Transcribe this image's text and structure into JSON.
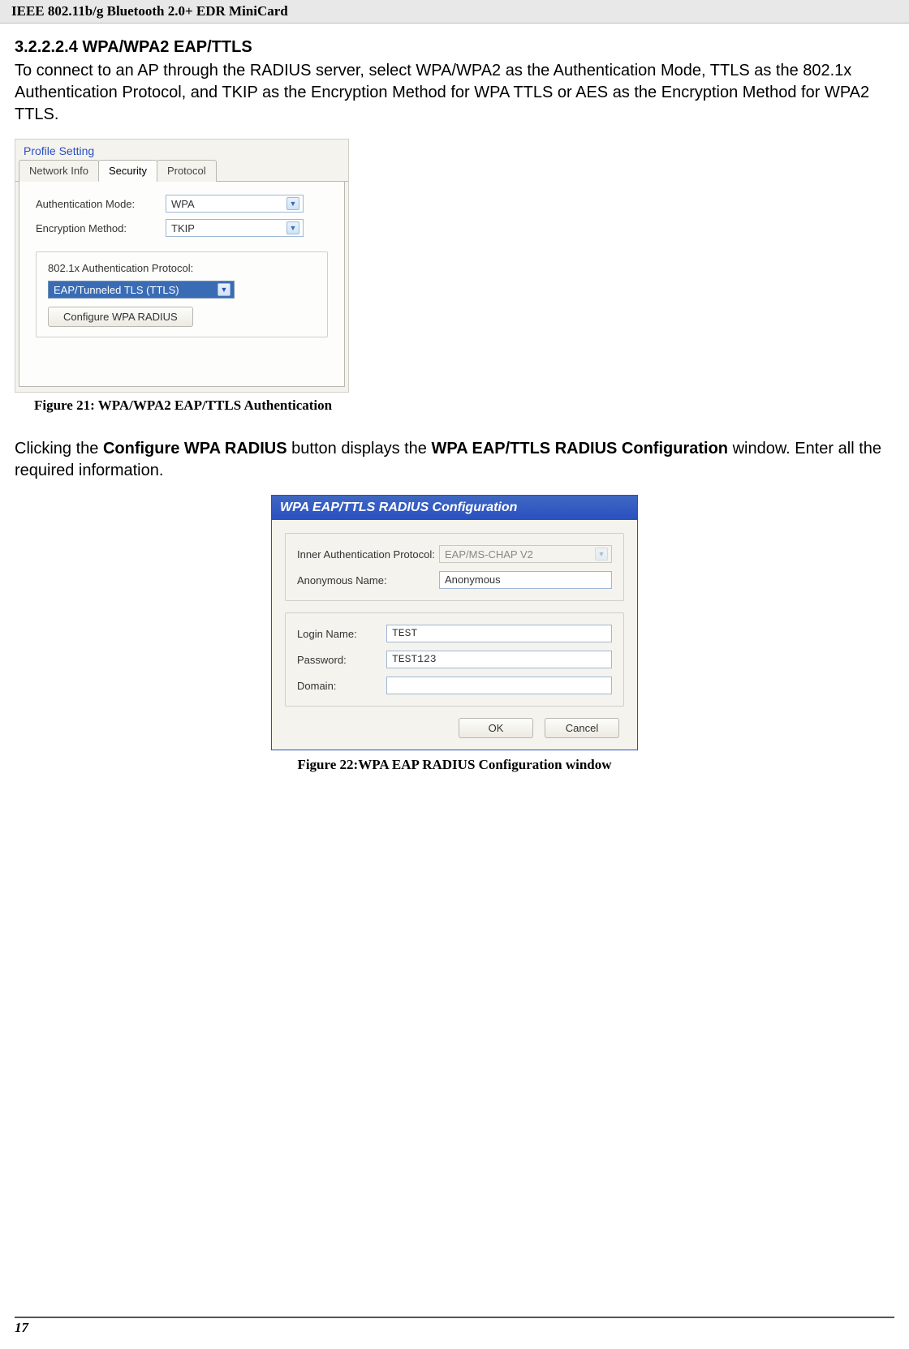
{
  "header": "IEEE 802.11b/g Bluetooth 2.0+ EDR MiniCard",
  "section_heading": "3.2.2.2.4 WPA/WPA2 EAP/TTLS",
  "intro_text": "To connect to an AP through the RADIUS server, select WPA/WPA2 as the Authentication Mode, TTLS as the 802.1x Authentication Protocol, and TKIP as the Encryption Method for WPA TTLS or AES as the Encryption Method for WPA2 TTLS.",
  "profile": {
    "group_label": "Profile Setting",
    "tabs": {
      "network": "Network Info",
      "security": "Security",
      "protocol": "Protocol"
    },
    "auth_mode_label": "Authentication Mode:",
    "auth_mode_value": "WPA",
    "enc_method_label": "Encryption Method:",
    "enc_method_value": "TKIP",
    "proto_label": "802.1x Authentication Protocol:",
    "proto_value": "EAP/Tunneled TLS (TTLS)",
    "configure_btn": "Configure WPA RADIUS"
  },
  "figure21_caption": "Figure 21: WPA/WPA2 EAP/TTLS Authentication",
  "mid_text_1": "Clicking the ",
  "mid_text_2": "Configure WPA RADIUS",
  "mid_text_3": " button displays the ",
  "mid_text_4": "WPA EAP/TTLS RADIUS Configuration",
  "mid_text_5": " window. Enter all the required information.",
  "dialog": {
    "title": "WPA EAP/TTLS RADIUS Configuration",
    "inner_proto_label": "Inner Authentication Protocol:",
    "inner_proto_value": "EAP/MS-CHAP V2",
    "anon_label": "Anonymous Name:",
    "anon_value": "Anonymous",
    "login_label": "Login Name:",
    "login_value": "TEST",
    "password_label": "Password:",
    "password_value": "TEST123",
    "domain_label": "Domain:",
    "domain_value": "",
    "ok": "OK",
    "cancel": "Cancel"
  },
  "figure22_caption": "Figure 22:WPA EAP RADIUS Configuration window",
  "page_number": "17"
}
